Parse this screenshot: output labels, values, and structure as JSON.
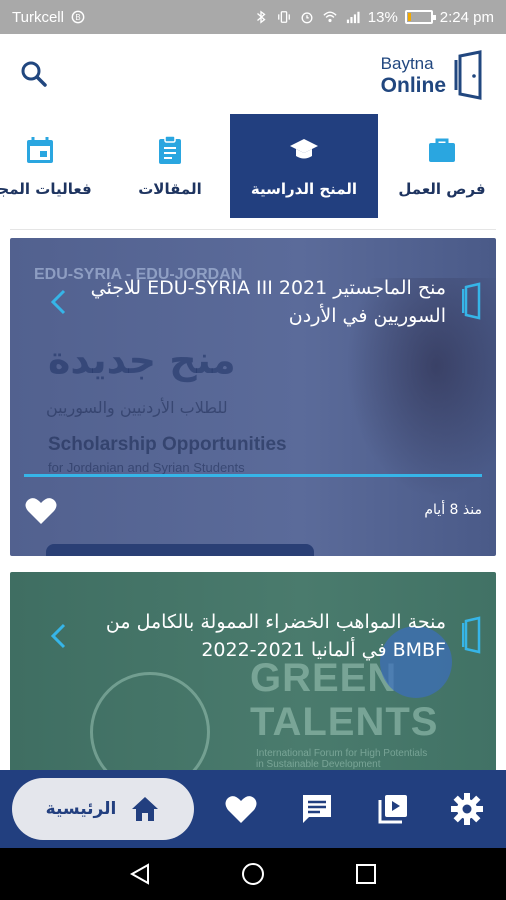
{
  "status_bar": {
    "carrier": "Turkcell",
    "battery_percent": "13%",
    "battery_level": 0.13,
    "time": "2:24 pm"
  },
  "app_bar": {
    "logo_line1": "Baytna",
    "logo_line2": "Online",
    "search_icon": "search-icon"
  },
  "tabs": [
    {
      "label": "فرص العمل",
      "icon": "briefcase-icon",
      "active": false
    },
    {
      "label": "المنح الدراسية",
      "icon": "graduation-cap-icon",
      "active": true
    },
    {
      "label": "المقالات",
      "icon": "clipboard-icon",
      "active": false
    },
    {
      "label": "فعاليات المجتمع",
      "icon": "calendar-icon",
      "active": false
    }
  ],
  "cards": [
    {
      "title": "منح الماجستير EDU-SYRIA III 2021 للاجئي السوريين في الأردن",
      "date": "منذ 8 أيام",
      "image_text": {
        "header": "EDU-SYRIA - EDU-JORDAN",
        "headline": "منح جديدة",
        "subheadline": "للطلاب الأردنيين والسوريين",
        "english_title": "Scholarship Opportunities",
        "english_subtitle": "for Jordanian and Syrian Students"
      }
    },
    {
      "title": "منحة المواهب الخضراء الممولة بالكامل من BMBF في ألمانيا 2021-2022",
      "image_text": {
        "big": "GREEN TALENTS",
        "small": "International Forum for High Potentials in Sustainable Development"
      }
    }
  ],
  "bottom_nav": {
    "home_label": "الرئيسية",
    "items": [
      "home-icon",
      "heart-icon",
      "chat-icon",
      "video-library-icon",
      "settings-icon"
    ]
  },
  "colors": {
    "primary": "#223f7f",
    "accent": "#36b5e8",
    "status_bar": "#a9a9a9"
  }
}
